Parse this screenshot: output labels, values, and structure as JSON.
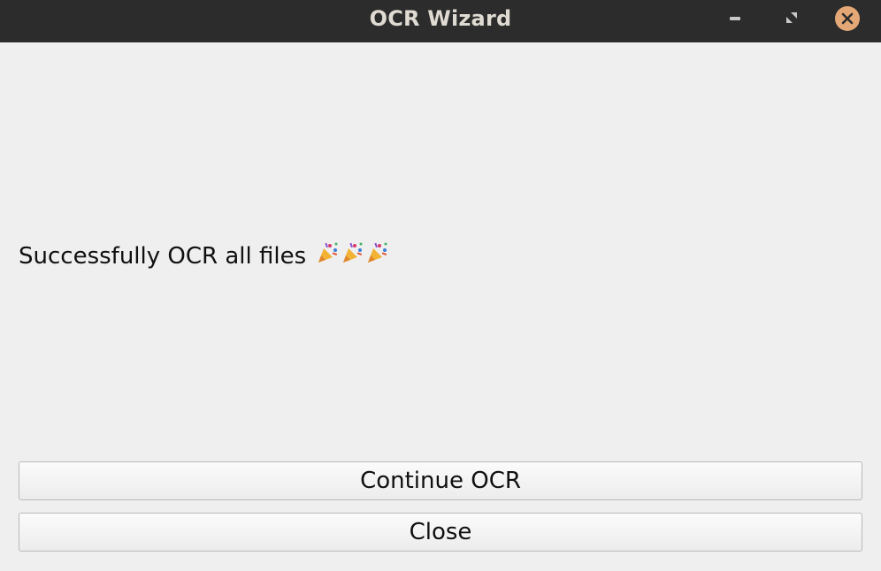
{
  "window": {
    "title": "OCR Wizard",
    "controls": {
      "minimize": "minimize-icon",
      "maximize": "maximize-icon",
      "close": "close-icon"
    }
  },
  "main": {
    "message": "Successfully OCR all files",
    "emojis": [
      "party-popper-icon",
      "party-popper-icon",
      "party-popper-icon"
    ]
  },
  "buttons": {
    "continue_label": "Continue OCR",
    "close_label": "Close"
  },
  "colors": {
    "titlebar": "#2c2c2c",
    "close_accent": "#e4a876",
    "background": "#efefef"
  }
}
